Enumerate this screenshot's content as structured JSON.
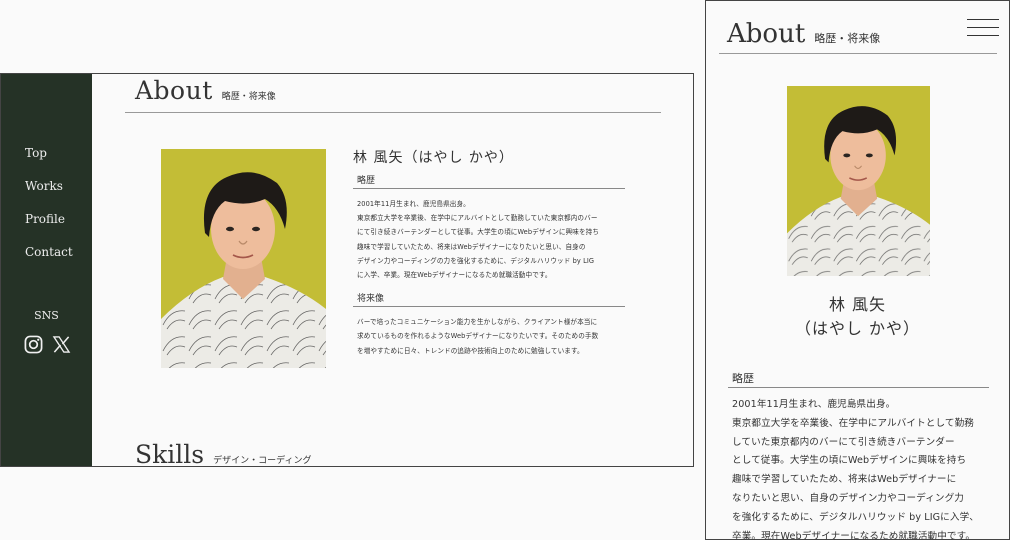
{
  "desktop": {
    "nav": [
      "Top",
      "Works",
      "Profile",
      "Contact"
    ],
    "sns_label": "SNS",
    "sns_icons": [
      "instagram-icon",
      "x-icon"
    ],
    "section_title": "About",
    "section_subtitle": "略歴・将来像",
    "name": "林 風矢（はやし かや）",
    "history_heading": "略歴",
    "history_lines": [
      "2001年11月生まれ、鹿児島県出身。",
      "東京都立大学を卒業後、在学中にアルバイトとして勤務していた東京都内のバー",
      "にて引き続きバーテンダーとして従事。大学生の頃にWebデザインに興味を持ち",
      "趣味で学習していたため、将来はWebデザイナーになりたいと思い、自身の",
      "デザイン力やコーディングの力を強化するために、デジタルハリウッド by LIG",
      "に入学、卒業。現在Webデザイナーになるため就職活動中です。"
    ],
    "future_heading": "将来像",
    "future_lines": [
      "バーで培ったコミュニケーション能力を生かしながら、クライアント様が本当に",
      "求めているものを作れるようなWebデザイナーになりたいです。そのための手数",
      "を増やすために日々、トレンドの追跡や技術向上のために勉強しています。"
    ],
    "skills_title": "Skills",
    "skills_subtitle": "デザイン・コーディング"
  },
  "mobile": {
    "section_title": "About",
    "section_subtitle": "略歴・将来像",
    "menu_icon": "hamburger-menu-icon",
    "name_line1": "林 風矢",
    "name_line2": "（はやし かや）",
    "history_heading": "略歴",
    "history_lines": [
      "2001年11月生まれ、鹿児島県出身。",
      "東京都立大学を卒業後、在学中にアルバイトとして勤務",
      "していた東京都内のバーにて引き続きバーテンダー",
      "として従事。大学生の頃にWebデザインに興味を持ち",
      "趣味で学習していたため、将来はWebデザイナーに",
      "なりたいと思い、自身のデザイン力やコーディング力",
      "を強化するために、デジタルハリウッド by LIGに入学、",
      "卒業。現在Webデザイナーになるため就職活動中です。"
    ]
  },
  "colors": {
    "sidebar_bg": "#253226",
    "photo_background": "#c7c03a"
  }
}
